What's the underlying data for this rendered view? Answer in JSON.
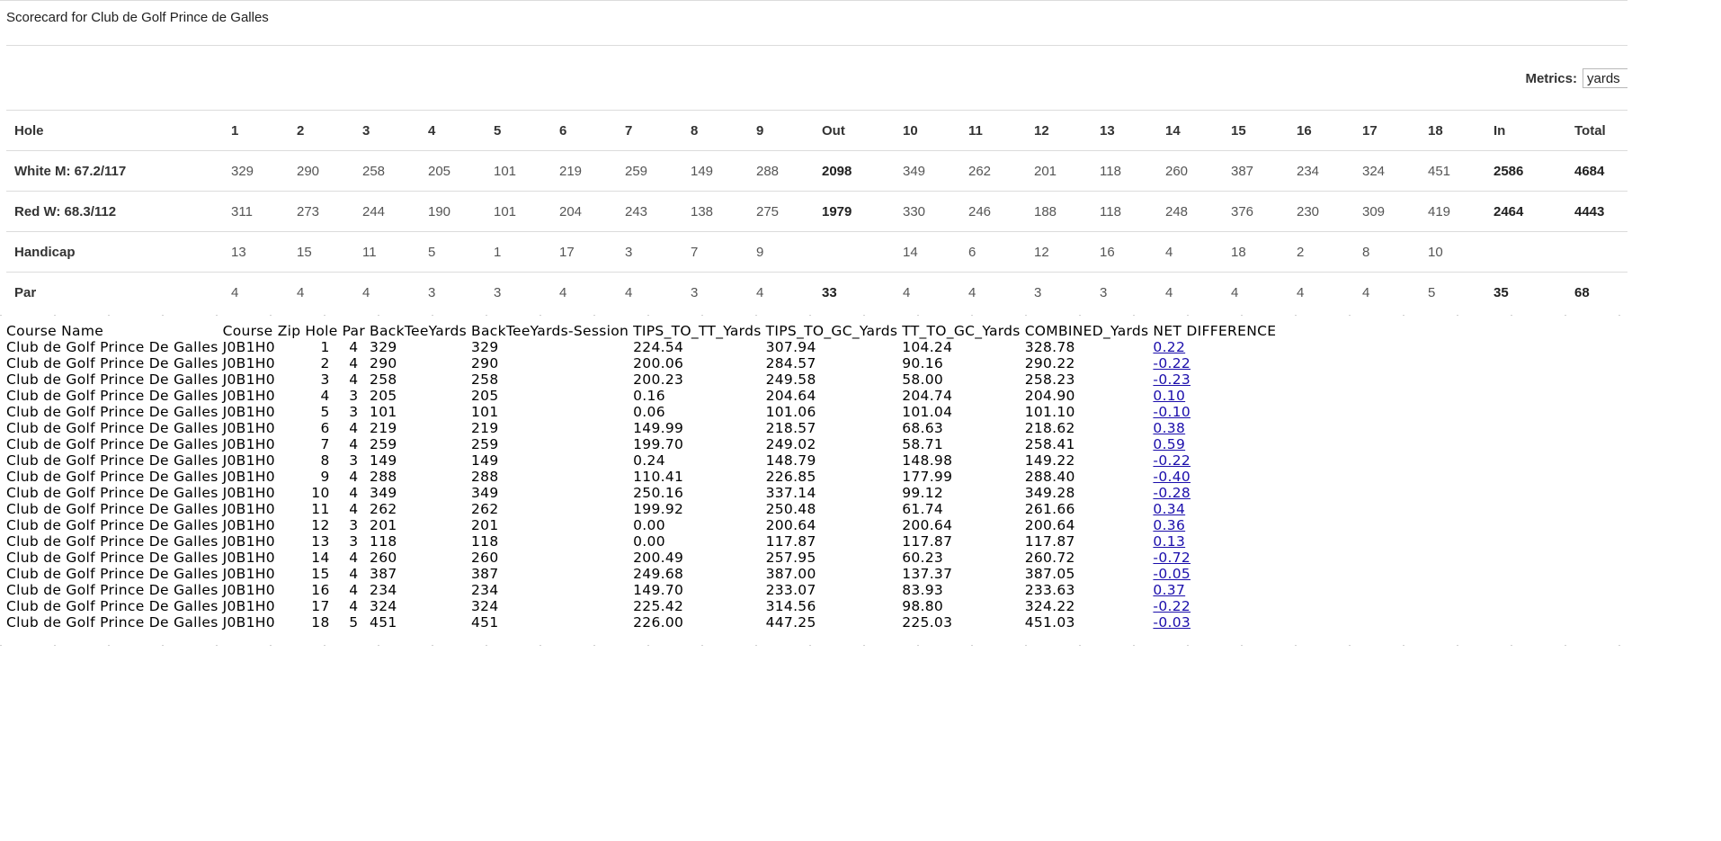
{
  "title": "Scorecard for Club de Golf Prince de Galles",
  "metrics": {
    "label": "Metrics:",
    "value": "yards"
  },
  "scorecard": {
    "header": [
      "Hole",
      "1",
      "2",
      "3",
      "4",
      "5",
      "6",
      "7",
      "8",
      "9",
      "Out",
      "10",
      "11",
      "12",
      "13",
      "14",
      "15",
      "16",
      "17",
      "18",
      "In",
      "Total"
    ],
    "rows": [
      {
        "label": "White M: 67.2/117",
        "cells": [
          "329",
          "290",
          "258",
          "205",
          "101",
          "219",
          "259",
          "149",
          "288",
          "2098",
          "349",
          "262",
          "201",
          "118",
          "260",
          "387",
          "234",
          "324",
          "451",
          "2586",
          "4684"
        ]
      },
      {
        "label": "Red W: 68.3/112",
        "cells": [
          "311",
          "273",
          "244",
          "190",
          "101",
          "204",
          "243",
          "138",
          "275",
          "1979",
          "330",
          "246",
          "188",
          "118",
          "248",
          "376",
          "230",
          "309",
          "419",
          "2464",
          "4443"
        ]
      },
      {
        "label": "Handicap",
        "cells": [
          "13",
          "15",
          "11",
          "5",
          "1",
          "17",
          "3",
          "7",
          "9",
          "",
          "14",
          "6",
          "12",
          "16",
          "4",
          "18",
          "2",
          "8",
          "10",
          "",
          ""
        ]
      },
      {
        "label": "Par",
        "cells": [
          "4",
          "4",
          "4",
          "3",
          "3",
          "4",
          "4",
          "3",
          "4",
          "33",
          "4",
          "4",
          "3",
          "3",
          "4",
          "4",
          "4",
          "4",
          "5",
          "35",
          "68"
        ]
      }
    ]
  },
  "data_table": {
    "columns": [
      "Course Name",
      "Course Zip",
      "Hole",
      "Par",
      "BackTeeYards",
      "BackTeeYards-Session",
      "TIPS_TO_TT_Yards",
      "TIPS_TO_GC_Yards",
      "TT_TO_GC_Yards",
      "COMBINED_Yards",
      "NET DIFFERENCE"
    ],
    "rows": [
      [
        "Club de Golf Prince De Galles",
        "J0B1H0",
        "1",
        "4",
        "329",
        "329",
        "224.54",
        "307.94",
        "104.24",
        "328.78",
        "0.22"
      ],
      [
        "Club de Golf Prince De Galles",
        "J0B1H0",
        "2",
        "4",
        "290",
        "290",
        "200.06",
        "284.57",
        "90.16",
        "290.22",
        "-0.22"
      ],
      [
        "Club de Golf Prince De Galles",
        "J0B1H0",
        "3",
        "4",
        "258",
        "258",
        "200.23",
        "249.58",
        "58.00",
        "258.23",
        "-0.23"
      ],
      [
        "Club de Golf Prince De Galles",
        "J0B1H0",
        "4",
        "3",
        "205",
        "205",
        "0.16",
        "204.64",
        "204.74",
        "204.90",
        "0.10"
      ],
      [
        "Club de Golf Prince De Galles",
        "J0B1H0",
        "5",
        "3",
        "101",
        "101",
        "0.06",
        "101.06",
        "101.04",
        "101.10",
        "-0.10"
      ],
      [
        "Club de Golf Prince De Galles",
        "J0B1H0",
        "6",
        "4",
        "219",
        "219",
        "149.99",
        "218.57",
        "68.63",
        "218.62",
        "0.38"
      ],
      [
        "Club de Golf Prince De Galles",
        "J0B1H0",
        "7",
        "4",
        "259",
        "259",
        "199.70",
        "249.02",
        "58.71",
        "258.41",
        "0.59"
      ],
      [
        "Club de Golf Prince De Galles",
        "J0B1H0",
        "8",
        "3",
        "149",
        "149",
        "0.24",
        "148.79",
        "148.98",
        "149.22",
        "-0.22"
      ],
      [
        "Club de Golf Prince De Galles",
        "J0B1H0",
        "9",
        "4",
        "288",
        "288",
        "110.41",
        "226.85",
        "177.99",
        "288.40",
        "-0.40"
      ],
      [
        "Club de Golf Prince De Galles",
        "J0B1H0",
        "10",
        "4",
        "349",
        "349",
        "250.16",
        "337.14",
        "99.12",
        "349.28",
        "-0.28"
      ],
      [
        "Club de Golf Prince De Galles",
        "J0B1H0",
        "11",
        "4",
        "262",
        "262",
        "199.92",
        "250.48",
        "61.74",
        "261.66",
        "0.34"
      ],
      [
        "Club de Golf Prince De Galles",
        "J0B1H0",
        "12",
        "3",
        "201",
        "201",
        "0.00",
        "200.64",
        "200.64",
        "200.64",
        "0.36"
      ],
      [
        "Club de Golf Prince De Galles",
        "J0B1H0",
        "13",
        "3",
        "118",
        "118",
        "0.00",
        "117.87",
        "117.87",
        "117.87",
        "0.13"
      ],
      [
        "Club de Golf Prince De Galles",
        "J0B1H0",
        "14",
        "4",
        "260",
        "260",
        "200.49",
        "257.95",
        "60.23",
        "260.72",
        "-0.72"
      ],
      [
        "Club de Golf Prince De Galles",
        "J0B1H0",
        "15",
        "4",
        "387",
        "387",
        "249.68",
        "387.00",
        "137.37",
        "387.05",
        "-0.05"
      ],
      [
        "Club de Golf Prince De Galles",
        "J0B1H0",
        "16",
        "4",
        "234",
        "234",
        "149.70",
        "233.07",
        "83.93",
        "233.63",
        "0.37"
      ],
      [
        "Club de Golf Prince De Galles",
        "J0B1H0",
        "17",
        "4",
        "324",
        "324",
        "225.42",
        "314.56",
        "98.80",
        "324.22",
        "-0.22"
      ],
      [
        "Club de Golf Prince De Galles",
        "J0B1H0",
        "18",
        "5",
        "451",
        "451",
        "226.00",
        "447.25",
        "225.03",
        "451.03",
        "-0.03"
      ]
    ]
  }
}
